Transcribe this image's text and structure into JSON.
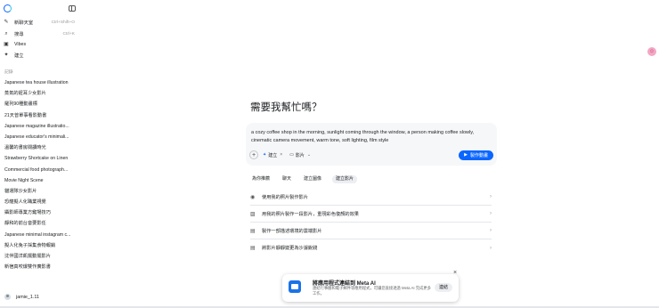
{
  "nav": [
    {
      "icon": "compose-icon",
      "label": "新聊天室",
      "shortcut": "Ctrl+Shift+O"
    },
    {
      "icon": "search-icon",
      "label": "搜尋",
      "shortcut": "Ctrl+K"
    },
    {
      "icon": "vibes-icon",
      "label": "Vibes",
      "shortcut": ""
    },
    {
      "icon": "create-icon",
      "label": "建立",
      "shortcut": ""
    }
  ],
  "history_label": "記錄",
  "history": [
    "Japanese tea house illustration",
    "蒸氣的鈕耳少女影片",
    "羅列90種動畫標",
    "21天曾單事看影動書",
    "Japanese magazine illustratio...",
    "Japanese educator's minimali...",
    "溫馨的書房閱讀時光",
    "Strawberry Shortcake on Linen",
    "Commercial food photograph...",
    "Movie Night Scene",
    "貓運隊沙女影片",
    "恐龍擬人化職業視覺",
    "攝影師專業方鍵場技巧",
    "靜和的前台音要影任",
    "Japanese minimal instagram c...",
    "擬人化兔子採集食物報銷",
    "沈伴國洋凱擺動擺影片",
    "新宿真咬爆雙作廣影書"
  ],
  "user": {
    "name": "jamie_1.11"
  },
  "main": {
    "title": "需要我幫忙嗎？",
    "prompt": "a cozy coffee shop in the morning, sunlight coming through the window, a person making coffee slowly, cinematic camera movement, warm tone, soft lighting, film style",
    "chip_create": "建立",
    "chip_video": "影片",
    "cta": "製作動畫",
    "tabs": [
      "為你推薦",
      "聊天",
      "建立圖像",
      "建立影片"
    ],
    "suggestions": [
      "使用我的照片製作影片",
      "用我的照片製作一段影片，重現彩色復顏的效果",
      "製作一部描述環境的雲端影片",
      "將影片靜靜變更為沙濾銳錢"
    ]
  },
  "toast": {
    "title": "將應用程式連結到 Meta AI",
    "body": "連結行事曆和電子郵件等應用程式，可讓您直接透過 Meta AI 完成更多工作。",
    "button": "連結"
  },
  "colors": {
    "accent": "#0a66ff",
    "avatar_pink": "#f3a7c4"
  }
}
